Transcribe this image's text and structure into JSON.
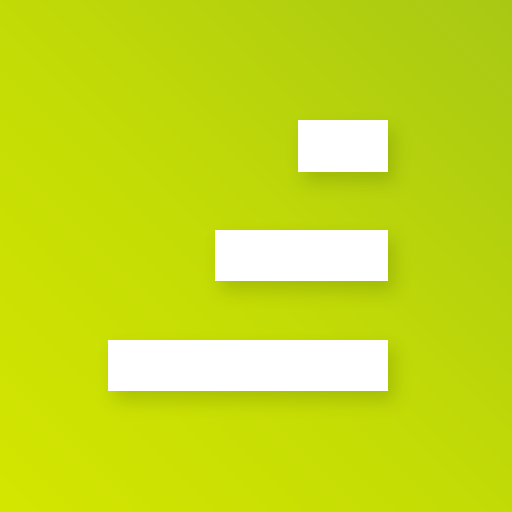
{
  "icon": {
    "name": "bar-stack-logo",
    "gradient_colors": [
      "#d4e600",
      "#c4dc05",
      "#a8c814"
    ],
    "bar_color": "#ffffff",
    "bars": [
      {
        "name": "short-bar",
        "relative_length": 0.32
      },
      {
        "name": "medium-bar",
        "relative_length": 0.62
      },
      {
        "name": "long-bar",
        "relative_length": 1.0
      }
    ]
  }
}
